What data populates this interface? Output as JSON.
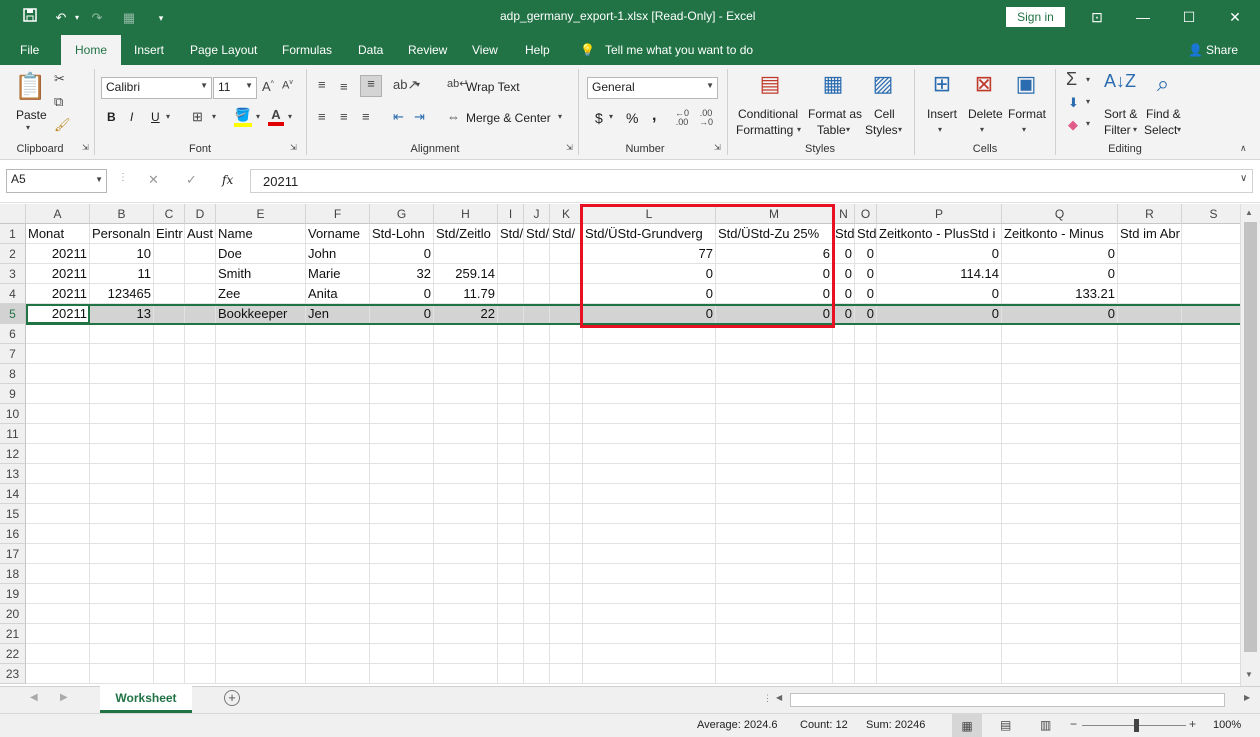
{
  "titlebar": {
    "filename": "adp_germany_export-1.xlsx  [Read-Only]  -  Excel",
    "signin": "Sign in"
  },
  "tabs": {
    "file": "File",
    "home": "Home",
    "insert": "Insert",
    "page_layout": "Page Layout",
    "formulas": "Formulas",
    "data": "Data",
    "review": "Review",
    "view": "View",
    "help": "Help",
    "tell_me": "Tell me what you want to do",
    "share": "Share"
  },
  "ribbon": {
    "clipboard": {
      "paste": "Paste",
      "group": "Clipboard"
    },
    "font": {
      "name": "Calibri",
      "size": "11",
      "bold": "B",
      "italic": "I",
      "underline": "U",
      "group": "Font"
    },
    "alignment": {
      "wrap": "Wrap Text",
      "merge": "Merge & Center",
      "group": "Alignment"
    },
    "number": {
      "format": "General",
      "currency": "$",
      "percent": "%",
      "comma": ",",
      "group": "Number"
    },
    "styles": {
      "conditional1": "Conditional",
      "conditional2": "Formatting",
      "format_as1": "Format as",
      "format_as2": "Table",
      "cell1": "Cell",
      "cell2": "Styles",
      "group": "Styles"
    },
    "cells": {
      "insert": "Insert",
      "delete": "Delete",
      "format": "Format",
      "group": "Cells"
    },
    "editing": {
      "sort1": "Sort &",
      "sort2": "Filter",
      "find1": "Find &",
      "find2": "Select",
      "group": "Editing"
    }
  },
  "formula_bar": {
    "name_box": "A5",
    "fx": "fx",
    "value": "20211"
  },
  "columns": [
    "A",
    "B",
    "C",
    "D",
    "E",
    "F",
    "G",
    "H",
    "I",
    "J",
    "K",
    "L",
    "M",
    "N",
    "O",
    "P",
    "Q",
    "R",
    "S"
  ],
  "rows": [
    [
      "Monat",
      "Personaln",
      "Eintr",
      "Aust",
      "Name",
      "Vorname",
      "Std-Lohn",
      "Std/Zeitlo",
      "Std/",
      "Std/",
      "Std/",
      "Std/ÜStd-Grundverg",
      "Std/ÜStd-Zu 25%",
      "Std",
      "Std",
      "Zeitkonto - PlusStd i",
      "Zeitkonto - Minus",
      "Std im AbrMonat",
      ""
    ],
    [
      "20211",
      "10",
      "",
      "",
      "Doe",
      "John",
      "0",
      "",
      "",
      "",
      "",
      "77",
      "6",
      "0",
      "0",
      "0",
      "0",
      "",
      ""
    ],
    [
      "20211",
      "11",
      "",
      "",
      "Smith",
      "Marie",
      "32",
      "259.14",
      "",
      "",
      "",
      "0",
      "0",
      "0",
      "0",
      "114.14",
      "0",
      "",
      ""
    ],
    [
      "20211",
      "123465",
      "",
      "",
      "Zee",
      "Anita",
      "0",
      "11.79",
      "",
      "",
      "",
      "0",
      "0",
      "0",
      "0",
      "0",
      "133.21",
      "",
      ""
    ],
    [
      "20211",
      "13",
      "",
      "",
      "Bookkeeper",
      "Jen",
      "0",
      "22",
      "",
      "",
      "",
      "0",
      "0",
      "0",
      "0",
      "0",
      "0",
      "",
      ""
    ]
  ],
  "row_numbers": [
    "1",
    "2",
    "3",
    "4",
    "5",
    "6",
    "7",
    "8",
    "9",
    "10",
    "11",
    "12",
    "13",
    "14",
    "15",
    "16",
    "17",
    "18",
    "19",
    "20",
    "21",
    "22",
    "23"
  ],
  "sheet_tab": "Worksheet",
  "status": {
    "average": "Average: 2024.6",
    "count": "Count: 12",
    "sum": "Sum: 20246",
    "zoom": "100%"
  },
  "colors": {
    "excel_green": "#217346",
    "highlight_red": "#e81123"
  }
}
